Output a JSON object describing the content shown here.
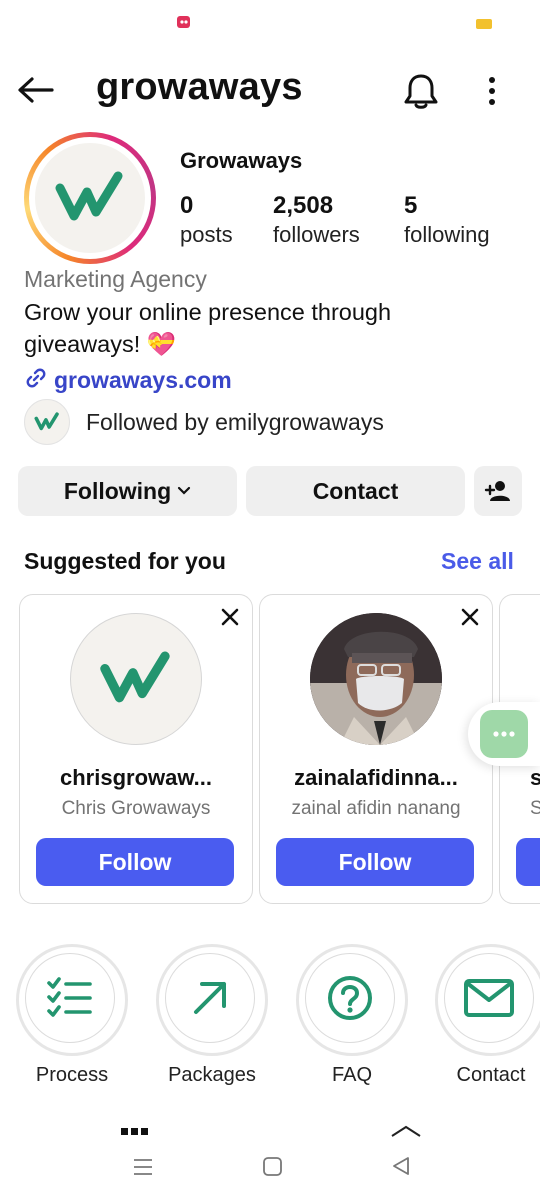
{
  "header": {
    "title": "growaways"
  },
  "profile": {
    "display_name": "Growaways",
    "stats": [
      {
        "value": "0",
        "label": "posts"
      },
      {
        "value": "2,508",
        "label": "followers"
      },
      {
        "value": "5",
        "label": "following"
      }
    ],
    "category": "Marketing Agency",
    "bio_line1": "Grow your online presence through",
    "bio_line2": "giveaways! 💝",
    "website": "growaways.com",
    "followed_by": "Followed by emilygrowaways"
  },
  "actions": {
    "following_label": "Following",
    "contact_label": "Contact"
  },
  "suggestions": {
    "title": "Suggested for you",
    "see_all": "See all",
    "cards": [
      {
        "username": "chrisgrowaw...",
        "full_name": "Chris Growaways",
        "follow_label": "Follow"
      },
      {
        "username": "zainalafidinna...",
        "full_name": "zainal afidin nanang",
        "follow_label": "Follow"
      },
      {
        "username": "s",
        "full_name": "S",
        "follow_label": ""
      }
    ]
  },
  "highlights": [
    {
      "label": "Process",
      "icon": "checklist-icon"
    },
    {
      "label": "Packages",
      "icon": "arrow-up-right-icon"
    },
    {
      "label": "FAQ",
      "icon": "question-icon"
    },
    {
      "label": "Contact",
      "icon": "mail-icon"
    }
  ],
  "colors": {
    "accent_green": "#23956f",
    "follow_blue": "#4a5cf0",
    "link_blue": "#3845c8",
    "button_grey": "#efefef"
  }
}
